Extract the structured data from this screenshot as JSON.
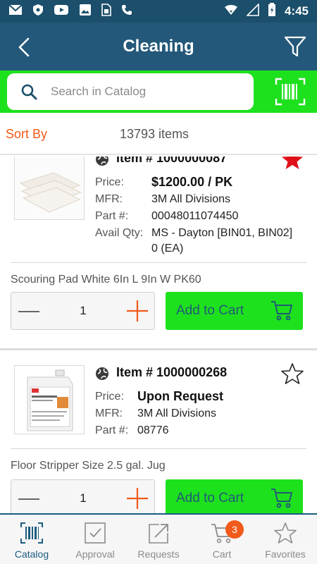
{
  "status_bar": {
    "time": "4:45",
    "icons": [
      "gmail-icon",
      "shield-icon",
      "youtube-icon",
      "image-icon",
      "sim-icon",
      "phone-icon",
      "wifi-icon",
      "signal-icon",
      "battery-icon"
    ]
  },
  "header": {
    "title": "Cleaning"
  },
  "search": {
    "placeholder": "Search in Catalog"
  },
  "sort": {
    "label": "Sort By",
    "count": "13793 items"
  },
  "items": [
    {
      "item_number": "Item # 1000000087",
      "favorite": true,
      "price_label": "Price:",
      "price": "$1200.00 / PK",
      "mfr_label": "MFR:",
      "mfr": "3M All Divisions",
      "part_label": "Part #:",
      "part": "00048011074450",
      "avail_label": "Avail Qty:",
      "avail_line1": "MS - Dayton [BIN01, BIN02]",
      "avail_line2": "0 (EA)",
      "description": "Scouring Pad White 6In L 9In W PK60",
      "qty": "1",
      "add_label": "Add to Cart"
    },
    {
      "item_number": "Item # 1000000268",
      "favorite": false,
      "price_label": "Price:",
      "price": "Upon Request",
      "mfr_label": "MFR:",
      "mfr": "3M All Divisions",
      "part_label": "Part #:",
      "part": "08776",
      "description": "Floor Stripper Size 2.5 gal. Jug",
      "qty": "1",
      "add_label": "Add to Cart"
    }
  ],
  "bottom_nav": {
    "items": [
      {
        "label": "Catalog",
        "icon": "barcode-icon",
        "active": true
      },
      {
        "label": "Approval",
        "icon": "approval-icon",
        "active": false
      },
      {
        "label": "Requests",
        "icon": "requests-icon",
        "active": false
      },
      {
        "label": "Cart",
        "icon": "cart-icon",
        "active": false,
        "badge": "3"
      },
      {
        "label": "Favorites",
        "icon": "star-icon",
        "active": false
      }
    ]
  },
  "colors": {
    "header": "#23587a",
    "status_bar": "#1b4f6b",
    "accent_green": "#1ee11e",
    "accent_orange": "#f05a1a",
    "favorite_red": "#e0101a"
  }
}
